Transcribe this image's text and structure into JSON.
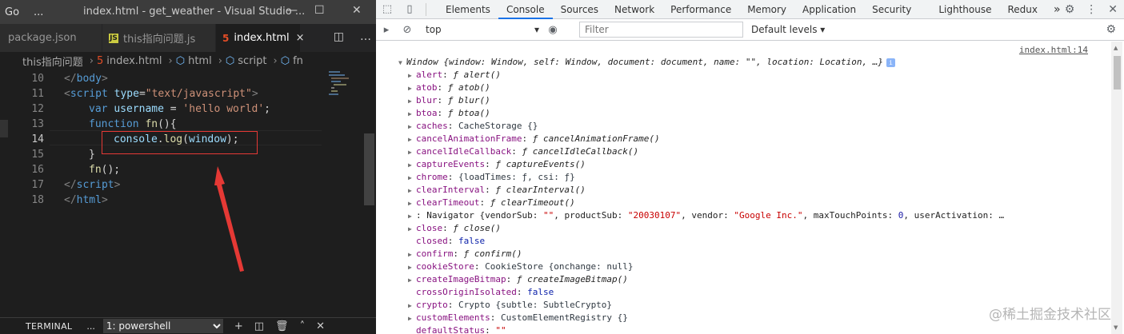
{
  "vscode": {
    "menu_first": "Go",
    "menu_more": "...",
    "window_title": "index.html - get_weather - Visual Studio ...",
    "tabs": [
      {
        "label": "package.json",
        "icon": "json-file-icon",
        "active": false
      },
      {
        "label": "this指向问题.js",
        "icon": "js-file-icon",
        "active": false
      },
      {
        "label": "index.html",
        "icon": "html-file-icon",
        "active": true
      }
    ],
    "close_glyph": "×",
    "breadcrumb": [
      "this指向问题",
      "index.html",
      "html",
      "script",
      "fn"
    ],
    "lines": [
      {
        "num": "10",
        "indent": 0,
        "tokens": [
          [
            "punc",
            "</"
          ],
          [
            "tag",
            "body"
          ],
          [
            "punc",
            ">"
          ]
        ]
      },
      {
        "num": "11",
        "indent": 0,
        "tokens": [
          [
            "punc",
            "<"
          ],
          [
            "tag",
            "script"
          ],
          [
            "plain",
            " "
          ],
          [
            "attr",
            "type"
          ],
          [
            "plain",
            "="
          ],
          [
            "str",
            "\"text/javascript\""
          ],
          [
            "punc",
            ">"
          ]
        ]
      },
      {
        "num": "12",
        "indent": 1,
        "tokens": [
          [
            "kw",
            "var"
          ],
          [
            "plain",
            " "
          ],
          [
            "var",
            "username"
          ],
          [
            "plain",
            " = "
          ],
          [
            "str",
            "'hello world'"
          ],
          [
            "plain",
            ";"
          ]
        ]
      },
      {
        "num": "13",
        "indent": 1,
        "tokens": [
          [
            "kw",
            "function"
          ],
          [
            "plain",
            " "
          ],
          [
            "fn",
            "fn"
          ],
          [
            "plain",
            "(){"
          ]
        ]
      },
      {
        "num": "14",
        "indent": 2,
        "tokens": [
          [
            "var",
            "console"
          ],
          [
            "plain",
            "."
          ],
          [
            "fn",
            "log"
          ],
          [
            "plain",
            "("
          ],
          [
            "var",
            "window"
          ],
          [
            "plain",
            ");"
          ]
        ]
      },
      {
        "num": "15",
        "indent": 1,
        "tokens": [
          [
            "plain",
            "}"
          ]
        ]
      },
      {
        "num": "16",
        "indent": 1,
        "tokens": [
          [
            "fn",
            "fn"
          ],
          [
            "plain",
            "();"
          ]
        ]
      },
      {
        "num": "17",
        "indent": 0,
        "tokens": [
          [
            "punc",
            "</"
          ],
          [
            "tag",
            "script"
          ],
          [
            "punc",
            ">"
          ]
        ]
      },
      {
        "num": "18",
        "indent": 0,
        "tokens": [
          [
            "punc",
            "</"
          ],
          [
            "tag",
            "html"
          ],
          [
            "punc",
            ">"
          ]
        ]
      }
    ],
    "current_line": "14",
    "terminal": {
      "label": "TERMINAL",
      "dots": "...",
      "shell": "1: powershell"
    }
  },
  "devtools": {
    "panels": [
      "Elements",
      "Console",
      "Sources",
      "Network",
      "Performance",
      "Memory",
      "Application",
      "Security",
      "Lighthouse",
      "Redux"
    ],
    "active_panel": "Console",
    "more": "»",
    "context": "top",
    "filter_placeholder": "Filter",
    "levels": "Default levels ▾",
    "source_link": "index.html:14",
    "header": "Window {window: Window, self: Window, document: document, name: \"\", location: Location, …}",
    "rows": [
      {
        "expand": true,
        "key": "alert",
        "parts": [
          [
            "val",
            ": "
          ],
          [
            "val italic",
            "ƒ alert()"
          ]
        ]
      },
      {
        "expand": true,
        "key": "atob",
        "parts": [
          [
            "val",
            ": "
          ],
          [
            "val italic",
            "ƒ atob()"
          ]
        ]
      },
      {
        "expand": true,
        "key": "blur",
        "parts": [
          [
            "val",
            ": "
          ],
          [
            "val italic",
            "ƒ blur()"
          ]
        ]
      },
      {
        "expand": true,
        "key": "btoa",
        "parts": [
          [
            "val",
            ": "
          ],
          [
            "val italic",
            "ƒ btoa()"
          ]
        ]
      },
      {
        "expand": true,
        "key": "caches",
        "parts": [
          [
            "val",
            ": "
          ],
          [
            "cls",
            "CacheStorage {}"
          ]
        ]
      },
      {
        "expand": true,
        "key": "cancelAnimationFrame",
        "parts": [
          [
            "val",
            ": "
          ],
          [
            "val italic",
            "ƒ cancelAnimationFrame()"
          ]
        ]
      },
      {
        "expand": true,
        "key": "cancelIdleCallback",
        "parts": [
          [
            "val",
            ": "
          ],
          [
            "val italic",
            "ƒ cancelIdleCallback()"
          ]
        ]
      },
      {
        "expand": true,
        "key": "captureEvents",
        "parts": [
          [
            "val",
            ": "
          ],
          [
            "val italic",
            "ƒ captureEvents()"
          ]
        ]
      },
      {
        "expand": true,
        "key": "chrome",
        "parts": [
          [
            "val",
            ": "
          ],
          [
            "cls",
            "{loadTimes: ƒ, csi: ƒ}"
          ]
        ]
      },
      {
        "expand": true,
        "key": "clearInterval",
        "parts": [
          [
            "val",
            ": "
          ],
          [
            "val italic",
            "ƒ clearInterval()"
          ]
        ]
      },
      {
        "expand": true,
        "key": "clearTimeout",
        "parts": [
          [
            "val",
            ": "
          ],
          [
            "val italic",
            "ƒ clearTimeout()"
          ]
        ]
      },
      {
        "expand": true,
        "key": "",
        "parts": [
          [
            "val",
            ": Navigator {vendorSub: "
          ],
          [
            "s",
            "\"\""
          ],
          [
            "val",
            ", productSub: "
          ],
          [
            "s",
            "\"20030107\""
          ],
          [
            "val",
            ", vendor: "
          ],
          [
            "s",
            "\"Google Inc.\""
          ],
          [
            "val",
            ", maxTouchPoints: "
          ],
          [
            "n",
            "0"
          ],
          [
            "val",
            ", userActivation: …"
          ]
        ]
      },
      {
        "expand": true,
        "key": "close",
        "parts": [
          [
            "val",
            ": "
          ],
          [
            "val italic",
            "ƒ close()"
          ]
        ]
      },
      {
        "expand": false,
        "key": "closed",
        "parts": [
          [
            "val",
            ": "
          ],
          [
            "b",
            "false"
          ]
        ]
      },
      {
        "expand": true,
        "key": "confirm",
        "parts": [
          [
            "val",
            ": "
          ],
          [
            "val italic",
            "ƒ confirm()"
          ]
        ]
      },
      {
        "expand": true,
        "key": "cookieStore",
        "parts": [
          [
            "val",
            ": "
          ],
          [
            "cls",
            "CookieStore {onchange: null}"
          ]
        ]
      },
      {
        "expand": true,
        "key": "createImageBitmap",
        "parts": [
          [
            "val",
            ": "
          ],
          [
            "val italic",
            "ƒ createImageBitmap()"
          ]
        ]
      },
      {
        "expand": false,
        "key": "crossOriginIsolated",
        "parts": [
          [
            "val",
            ": "
          ],
          [
            "b",
            "false"
          ]
        ]
      },
      {
        "expand": true,
        "key": "crypto",
        "parts": [
          [
            "val",
            ": "
          ],
          [
            "cls",
            "Crypto {subtle: SubtleCrypto}"
          ]
        ]
      },
      {
        "expand": true,
        "key": "customElements",
        "parts": [
          [
            "val",
            ": "
          ],
          [
            "cls",
            "CustomElementRegistry {}"
          ]
        ]
      },
      {
        "expand": false,
        "key": "defaultStatus",
        "parts": [
          [
            "val",
            ": "
          ],
          [
            "s",
            "\"\""
          ]
        ]
      }
    ],
    "watermark": "@稀土掘金技术社区"
  }
}
